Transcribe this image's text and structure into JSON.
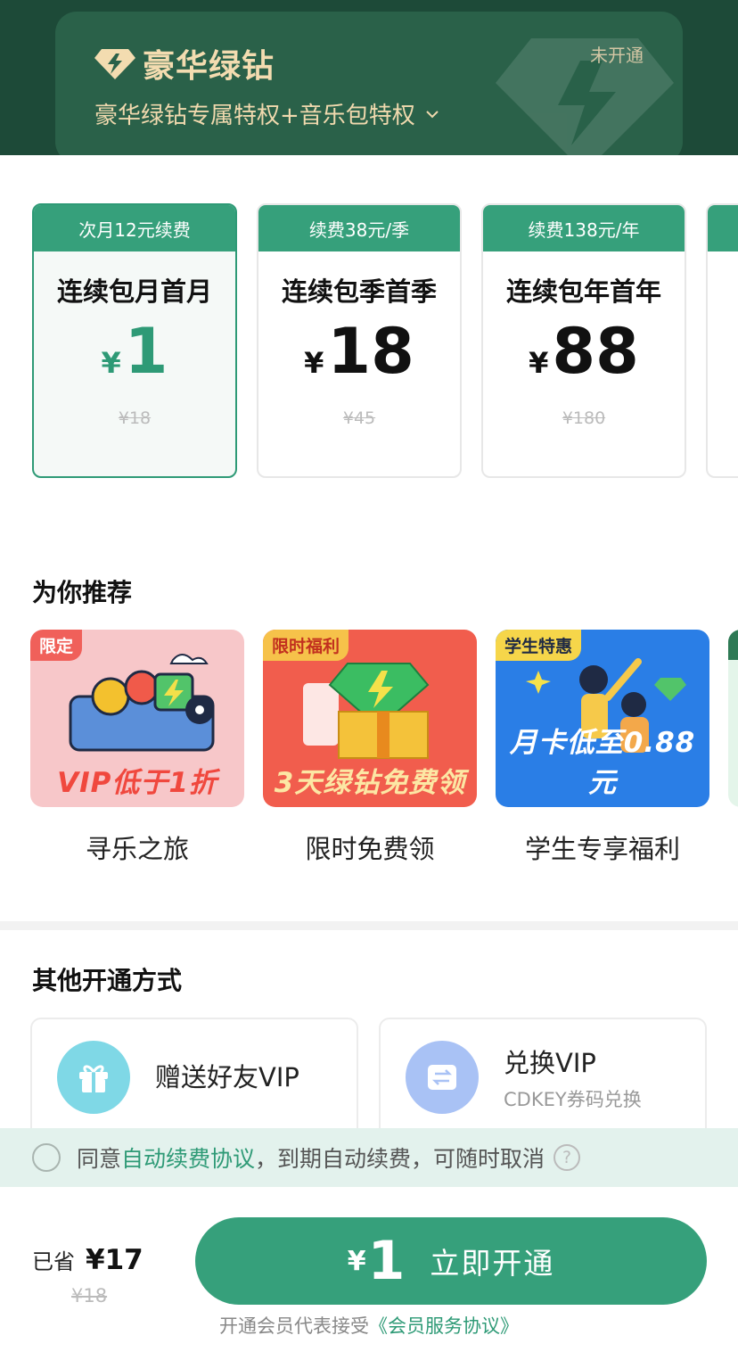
{
  "header": {
    "brand_title": "豪华绿钻",
    "status": "未开通",
    "subtitle": "豪华绿钻专属特权+音乐包特权"
  },
  "plans": [
    {
      "tag": "次月12元续费",
      "name": "连续包月首月",
      "currency": "¥",
      "price": "1",
      "original": "¥18",
      "selected": true
    },
    {
      "tag": "续费38元/季",
      "name": "连续包季首季",
      "currency": "¥",
      "price": "18",
      "original": "¥45",
      "selected": false
    },
    {
      "tag": "续费138元/年",
      "name": "连续包年首年",
      "currency": "¥",
      "price": "88",
      "original": "¥180",
      "selected": false
    }
  ],
  "recommend": {
    "title": "为你推荐",
    "items": [
      {
        "badge": "限定",
        "banner": "VIP低于1折",
        "label": "寻乐之旅"
      },
      {
        "badge": "限时福利",
        "banner": "3天绿钻免费领",
        "label": "限时免费领"
      },
      {
        "badge": "学生特惠",
        "banner": "月卡低至0.88元",
        "label": "学生专享福利"
      }
    ]
  },
  "other": {
    "title": "其他开通方式",
    "gift": {
      "title": "赠送好友VIP"
    },
    "redeem": {
      "title": "兑换VIP",
      "subtitle": "CDKEY券码兑换"
    }
  },
  "agreement": {
    "prefix": "同意",
    "link": "自动续费协议",
    "suffix": "，到期自动续费，可随时取消",
    "help": "?"
  },
  "footer": {
    "saved_label": "已省",
    "saved_amount": "¥17",
    "original": "¥18",
    "pay_currency": "¥",
    "pay_amount": "1",
    "pay_label": "立即开通",
    "terms_prefix": "开通会员代表接受",
    "terms_link": "《会员服务协议》"
  },
  "colors": {
    "accent": "#36a07b",
    "header_bg": "#1d4a38",
    "gold": "#f3dcb0"
  }
}
